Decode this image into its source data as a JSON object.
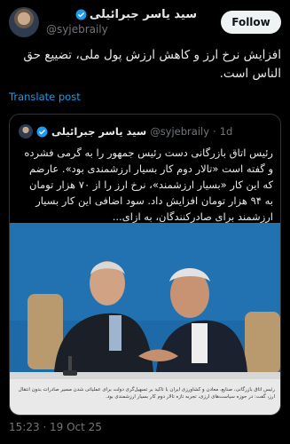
{
  "author": {
    "display_name": "سید یاسر جبرائیلی",
    "handle": "@syjebraily",
    "follow_label": "Follow"
  },
  "tweet": {
    "text": "افزایش نرخ ارز و کاهش ارزش پول ملی، تضییع حق الناس است.",
    "translate_label": "Translate post",
    "timestamp": "15:23 · 19 Oct 25"
  },
  "quote": {
    "display_name": "سید یاسر جبرائیلی",
    "handle": "@syjebraily",
    "separator": "·",
    "time": "1d",
    "text": "رئیس اتاق بازرگانی دست رئیس جمهور را به گرمی فشرده و گفته است «تالار دوم کار بسیار ارزشمندی بود». عارضم که این کار «بسیار ارزشمند»، نرخ ارز را از ۷۰ هزار تومان به ۹۴ هزار تومان افزایش داد. سود اضافی این کار بسیار ارزشمند برای صادرکنندگان، به ازای...",
    "image_caption": "رئیس اتاق بازرگانی، صنایع، معادن و کشاورزی ایران با تاکید بر تسهیل‌گری دولت برای عملیاتی شدن مسیر صادرات بدون انتقال ارز، گفت: در حوزه سیاست‌های ارزی، تجربه تازه تالار دوم کار بسیار ارزشمندی بود."
  },
  "colors": {
    "background": "#000000",
    "text": "#e7e9ea",
    "muted": "#71767b",
    "link": "#1d9bf0",
    "verified": "#1d9bf0",
    "photo_backdrop": "#1e6aa9"
  },
  "icons": {
    "verified": "verified-badge-icon"
  }
}
